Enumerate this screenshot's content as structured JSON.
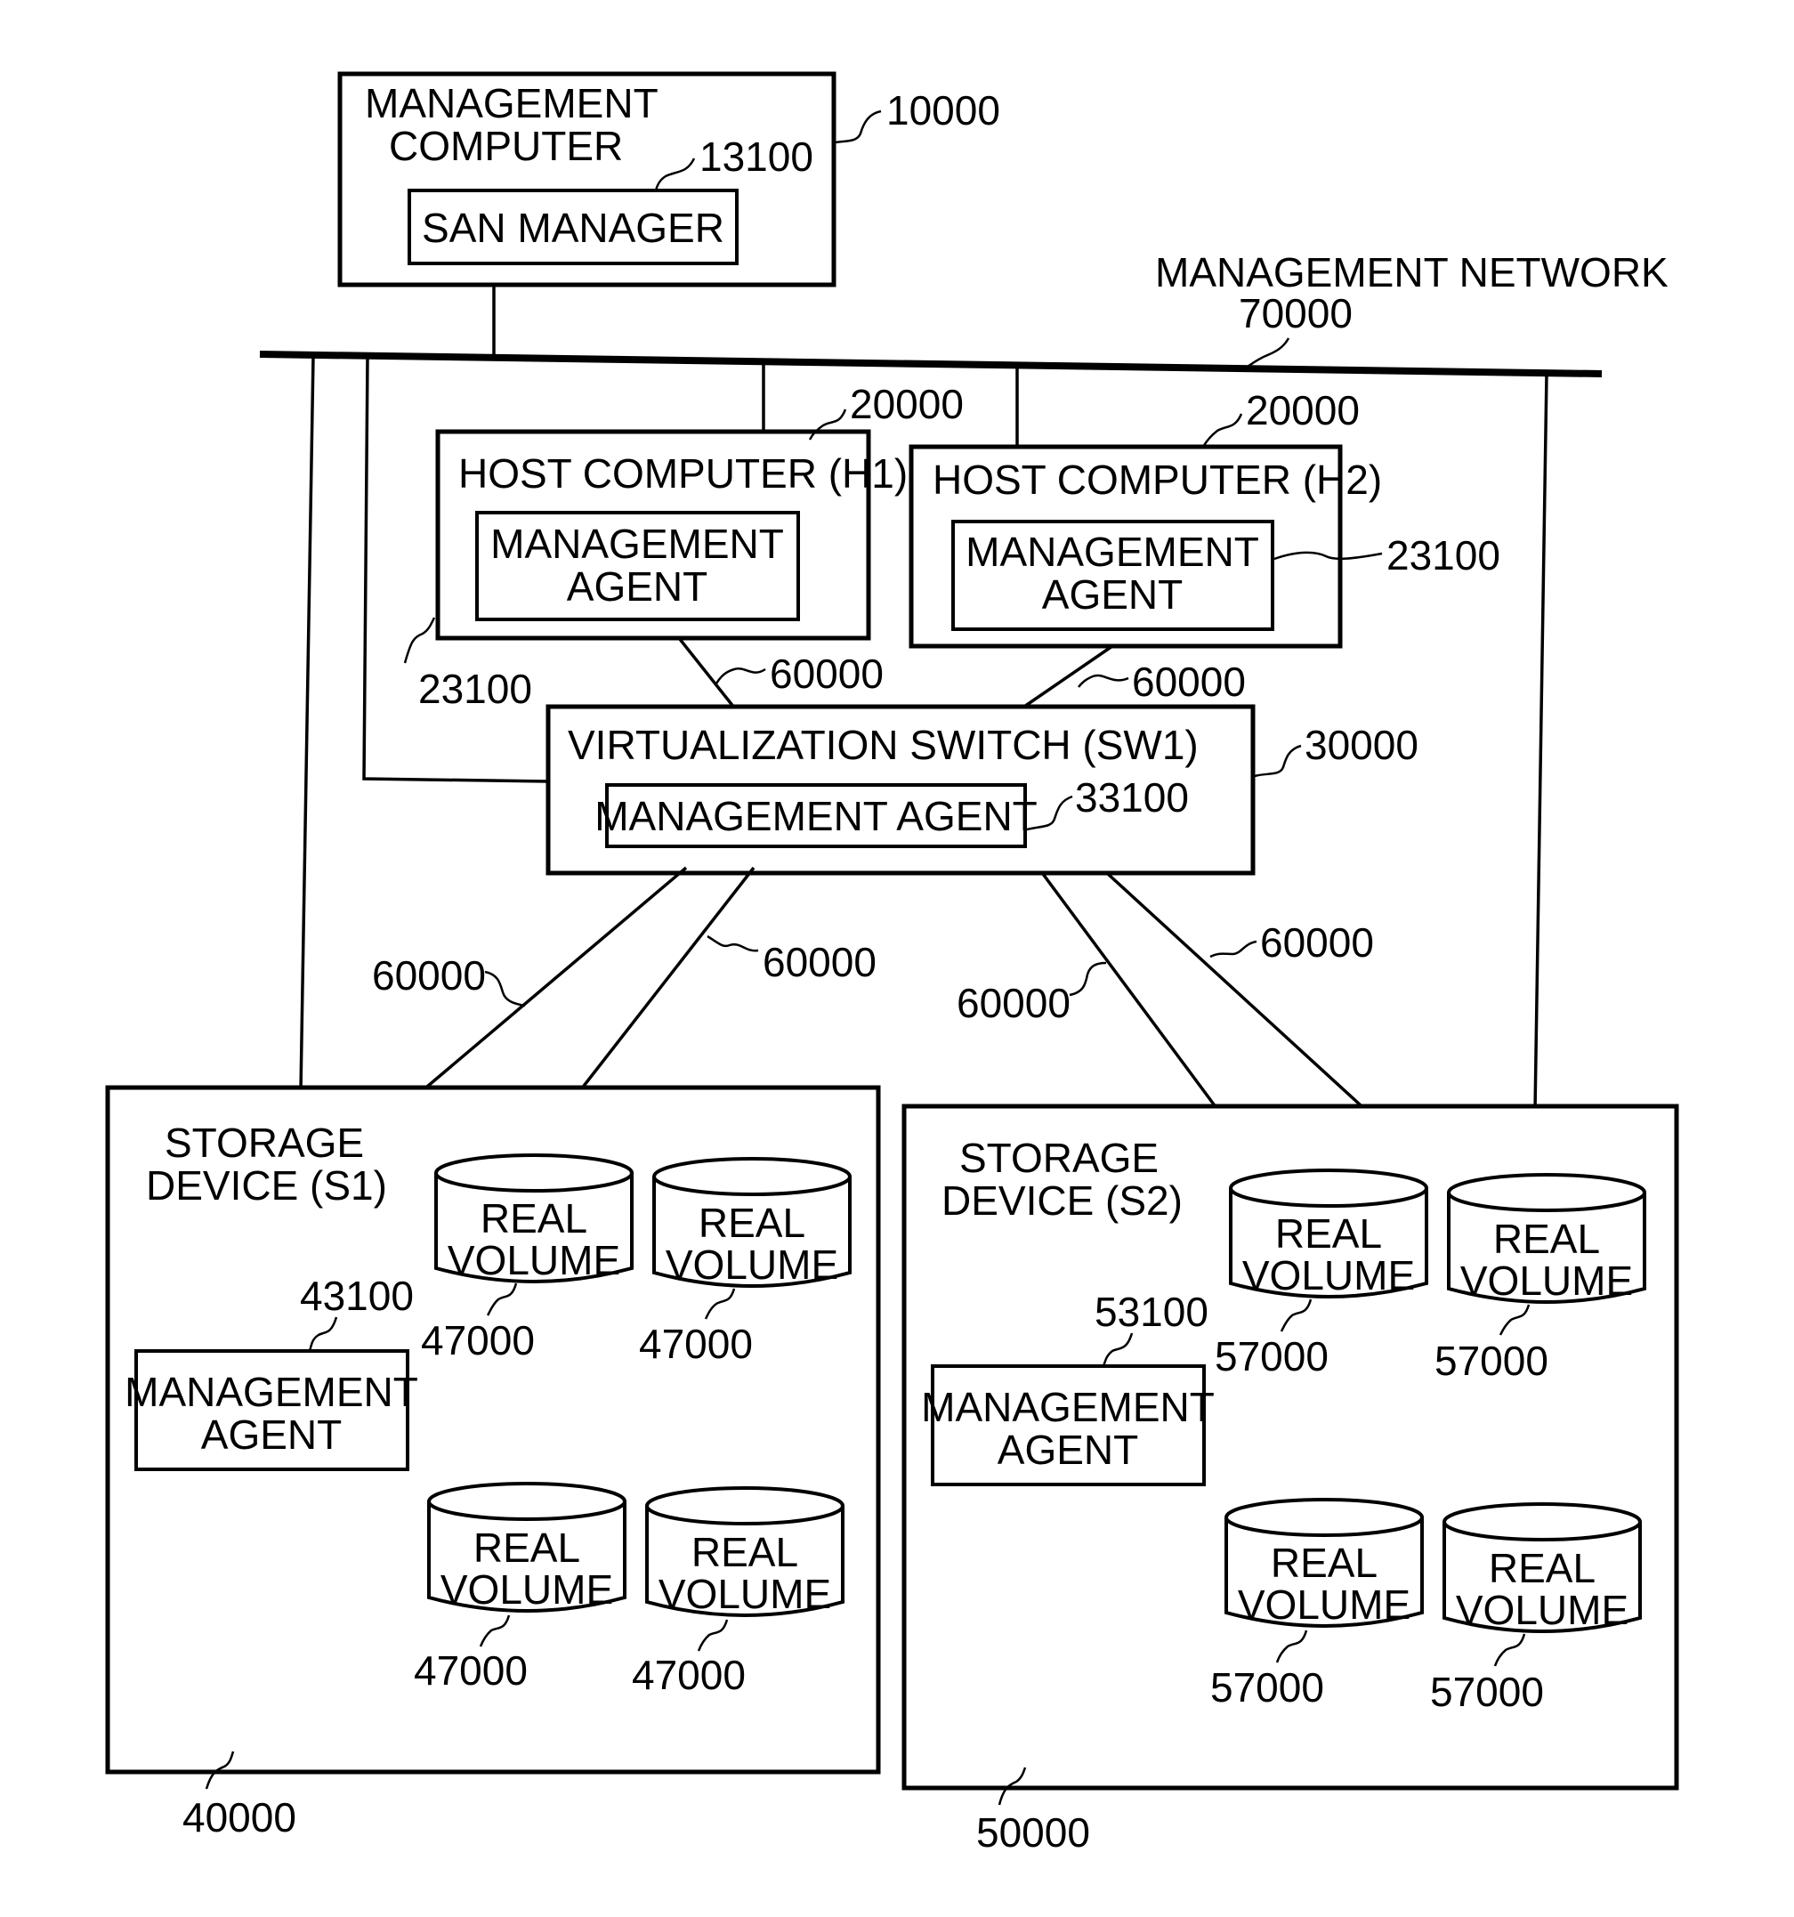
{
  "diagram": {
    "management_computer": {
      "title_line1": "MANAGEMENT",
      "title_line2": "COMPUTER",
      "ref": "10000",
      "san_manager": {
        "label": "SAN MANAGER",
        "ref": "13100"
      }
    },
    "management_network": {
      "label": "MANAGEMENT NETWORK",
      "ref": "70000"
    },
    "hosts": [
      {
        "title": "HOST COMPUTER (H1)",
        "ref": "20000",
        "agent": {
          "line1": "MANAGEMENT",
          "line2": "AGENT",
          "ref": "23100"
        },
        "link_ref": "60000"
      },
      {
        "title": "HOST COMPUTER (H2)",
        "ref": "20000",
        "agent": {
          "line1": "MANAGEMENT",
          "line2": "AGENT",
          "ref": "23100"
        },
        "link_ref": "60000"
      }
    ],
    "switch": {
      "title": "VIRTUALIZATION SWITCH (SW1)",
      "ref": "30000",
      "agent": {
        "label": "MANAGEMENT AGENT",
        "ref": "33100"
      },
      "link_refs": [
        "60000",
        "60000",
        "60000",
        "60000"
      ]
    },
    "storage": [
      {
        "title_line1": "STORAGE",
        "title_line2": "DEVICE (S1)",
        "ref": "40000",
        "agent": {
          "line1": "MANAGEMENT",
          "line2": "AGENT",
          "ref": "43100"
        },
        "volumes": [
          {
            "line1": "REAL",
            "line2": "VOLUME",
            "ref": "47000"
          },
          {
            "line1": "REAL",
            "line2": "VOLUME",
            "ref": "47000"
          },
          {
            "line1": "REAL",
            "line2": "VOLUME",
            "ref": "47000"
          },
          {
            "line1": "REAL",
            "line2": "VOLUME",
            "ref": "47000"
          }
        ]
      },
      {
        "title_line1": "STORAGE",
        "title_line2": "DEVICE (S2)",
        "ref": "50000",
        "agent": {
          "line1": "MANAGEMENT",
          "line2": "AGENT",
          "ref": "53100"
        },
        "volumes": [
          {
            "line1": "REAL",
            "line2": "VOLUME",
            "ref": "57000"
          },
          {
            "line1": "REAL",
            "line2": "VOLUME",
            "ref": "57000"
          },
          {
            "line1": "REAL",
            "line2": "VOLUME",
            "ref": "57000"
          },
          {
            "line1": "REAL",
            "line2": "VOLUME",
            "ref": "57000"
          }
        ]
      }
    ]
  }
}
